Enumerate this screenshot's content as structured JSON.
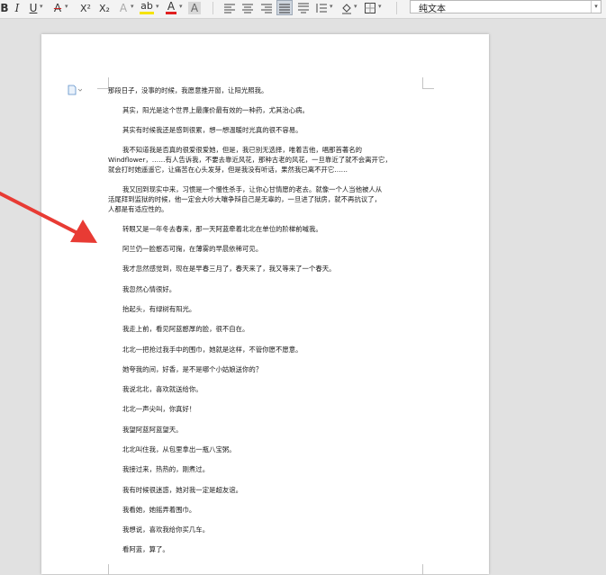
{
  "toolbar": {
    "bold": "B",
    "italic": "I",
    "underline": "U",
    "strikethrough": "A",
    "superscript": "X²",
    "subscript": "X₂",
    "text_effect": "A",
    "highlight": "ab",
    "font_color": "A",
    "char_shading": "A",
    "style_box_value": "纯文本",
    "colors": {
      "font_color_bar": "#e02020",
      "highlight_bar": "#f5e300",
      "strike_color": "#d02020"
    }
  },
  "document": {
    "paragraphs": [
      [
        "那段日子，没事的时候，我愿意推开窗，让阳光照我。"
      ],
      [
        "其实，阳光是这个世界上最廉价最有效的一种药，尤其治心病。"
      ],
      [
        "其实有时候我还是感到很累，想一想温暖时光真的很不容易。"
      ],
      [
        "我不知道我是否真的很爱很爱她，但是，我已别无选择，唯着吉他，唱那首著名的",
        "Windflower，……有人告诉我，不要去靠近风花，那种古老的风花，一旦靠近了就不会离开它，",
        "就会打时她遥遥它，让痛苦在心头发芽，但是我没有听话，果然我已离不开它……"
      ],
      [
        "我又回到现实中来，习惯是一个慢性杀手，让你心甘情愿的老去。就像一个人当他被人从",
        "活尾拜到监狱的时候，他一定会大吵大嚷争辩自己是无辜的，一旦进了狱房，就不再抗议了，",
        "人都是有适应性的。"
      ],
      [
        "转眼又是一年冬去春来，那一天阿蓝牵着北北在单位的阶梯前喊我。"
      ],
      [
        "阿兰仍一脸憨态可掬，在薄雾的早晨依稀可见。"
      ],
      [
        "我才忽然感觉到，现在是早春三月了，春天来了，我又等来了一个春天。"
      ],
      [
        "我忽然心情很好。"
      ],
      [
        "抬起头，有绿树有阳光。"
      ],
      [
        "我走上前，看见阿蓝憨厚的脸，很不自在。"
      ],
      [
        "北北一把抢过我手中的围巾，她就是这样，不管你愿不愿意。"
      ],
      [
        "她夸我的间，好香，是不是哪个小姑娘送你的？"
      ],
      [
        "我说北北，喜欢就送给你。"
      ],
      [
        "北北一声尖叫，你真好！"
      ],
      [
        "我望阿蓝阿蓝望天。"
      ],
      [
        "北北叫住我，从包里拿出一瓶八宝粥。"
      ],
      [
        "我接过来，热热的，刚煮过。"
      ],
      [
        "我有时候很迷惑，她对我一定是超友谊。"
      ],
      [
        "我看她，她摇弄着围巾。"
      ],
      [
        "我想说，喜欢我给你买几车。"
      ],
      [
        "看阿蓝，算了。"
      ]
    ]
  },
  "annotation": {
    "arrow_color": "#e83b34"
  }
}
